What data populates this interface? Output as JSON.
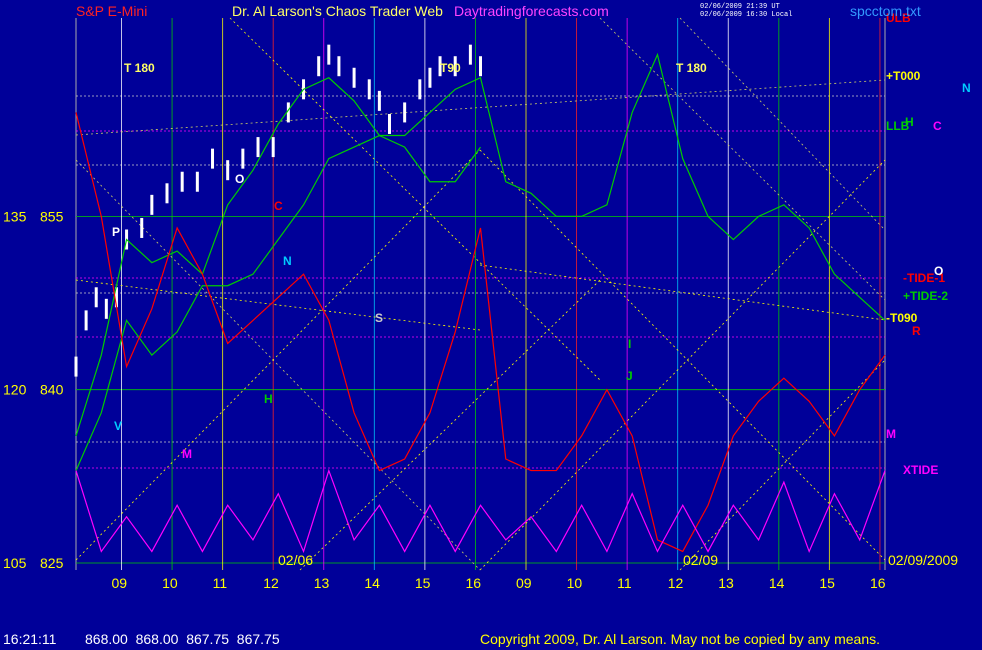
{
  "header": {
    "symbol": "S&P E-Mini",
    "title": "Dr. Al Larson's Chaos Trader Web",
    "site": "Daytradingforecasts.com",
    "stamp_line1": "02/06/2009 21:39 UT",
    "stamp_line2": "02/06/2009 16:30 Local",
    "file": "spcctom.txt"
  },
  "footer": {
    "time": "16:21:11",
    "ohlc": "868.00  868.00  867.75  867.75",
    "copyright": "Copyright 2009, Dr. Al Larson. May not be copied by any means."
  },
  "colors": {
    "background": "#000099",
    "price": "#ffffff",
    "green_line": "#00cc00",
    "red_line": "#ff0000",
    "magenta_line": "#ff00ff",
    "yellow": "#ffff00",
    "cyan": "#00ccff"
  },
  "chart_data": {
    "type": "line",
    "title": "S&P E-Mini",
    "y_ticks": [
      {
        "left": "135",
        "right": "855",
        "value": 855
      },
      {
        "left": "120",
        "right": "840",
        "value": 840
      },
      {
        "left": "105",
        "right": "825",
        "value": 825
      }
    ],
    "ylim": [
      825,
      872
    ],
    "x_ticks": [
      "09",
      "10",
      "11",
      "12",
      "13",
      "14",
      "15",
      "16",
      "09",
      "10",
      "11",
      "12",
      "13",
      "14",
      "15",
      "16"
    ],
    "date_labels": [
      "02/06",
      "02/09",
      "02/09/2009"
    ],
    "right_labels": [
      "ULB",
      "+T000",
      "LLB",
      "-TIDE-1",
      "+TIDE-2",
      "-T090",
      "R",
      "M",
      "XTIDE"
    ],
    "side_letters": [
      "N",
      "H",
      "C",
      "O"
    ],
    "annotations": [
      "T 180",
      "T90",
      "T 180",
      "O",
      "C",
      "P",
      "N",
      "S",
      "H",
      "M",
      "V",
      "I",
      "J"
    ],
    "series": [
      {
        "name": "price",
        "kind": "bars",
        "x": [
          0.0,
          0.2,
          0.4,
          0.6,
          0.8,
          1.0,
          1.3,
          1.5,
          1.8,
          2.1,
          2.4,
          2.7,
          3.0,
          3.3,
          3.6,
          3.9,
          4.2,
          4.5,
          4.8,
          5.0,
          5.2,
          5.5,
          5.8,
          6.0,
          6.2,
          6.5,
          6.8,
          7.0,
          7.2,
          7.5,
          7.8,
          8.0
        ],
        "y": [
          842,
          846,
          848,
          847,
          848,
          853,
          854,
          856,
          857,
          858,
          858,
          860,
          859,
          860,
          861,
          861,
          864,
          866,
          868,
          869,
          868,
          867,
          866,
          865,
          863,
          864,
          866,
          867,
          868,
          868,
          869,
          868
        ]
      },
      {
        "name": "green_upper",
        "x": [
          0,
          0.5,
          1,
          1.5,
          2,
          2.5,
          3,
          3.5,
          4,
          4.5,
          5,
          5.5,
          6,
          6.5,
          7,
          7.5,
          8,
          8.5,
          9,
          9.5,
          10,
          10.5,
          11,
          11.5,
          12,
          12.5,
          13,
          13.5,
          14,
          14.5,
          15,
          15.5,
          16
        ],
        "y": [
          836,
          843,
          853,
          851,
          852,
          850,
          856,
          859,
          863,
          866,
          867,
          865,
          862,
          862,
          864,
          866,
          867,
          858,
          857,
          855,
          855,
          856,
          864,
          869,
          860,
          855,
          853,
          855,
          856,
          854,
          850,
          848,
          846
        ]
      },
      {
        "name": "green_lower",
        "x": [
          0,
          0.5,
          1,
          1.5,
          2,
          2.5,
          3,
          3.5,
          4,
          4.5,
          5,
          5.5,
          6,
          6.5,
          7,
          7.5,
          8
        ],
        "y": [
          833,
          838,
          846,
          843,
          845,
          849,
          849,
          850,
          853,
          856,
          860,
          861,
          862,
          861,
          858,
          858,
          861
        ]
      },
      {
        "name": "red_cycle",
        "x": [
          0,
          0.5,
          1,
          1.5,
          2,
          2.5,
          3,
          3.5,
          4,
          4.5,
          5,
          5.5,
          6,
          6.5,
          7,
          7.5,
          8,
          8.5,
          9,
          9.5,
          10,
          10.5,
          11,
          11.5,
          12,
          12.5,
          13,
          13.5,
          14,
          14.5,
          15,
          15.5,
          16
        ],
        "y": [
          864,
          855,
          842,
          847,
          854,
          850,
          844,
          846,
          848,
          850,
          846,
          838,
          833,
          834,
          838,
          845,
          854,
          834,
          833,
          833,
          836,
          840,
          836,
          827,
          826,
          830,
          836,
          839,
          841,
          839,
          836,
          840,
          843
        ]
      },
      {
        "name": "xtide",
        "x": [
          0,
          0.5,
          1,
          1.5,
          2,
          2.5,
          3,
          3.5,
          4,
          4.5,
          5,
          5.5,
          6,
          6.5,
          7,
          7.5,
          8,
          8.5,
          9,
          9.5,
          10,
          10.5,
          11,
          11.5,
          12,
          12.5,
          13,
          13.5,
          14,
          14.5,
          15,
          15.5,
          16
        ],
        "y": [
          833,
          826,
          829,
          826,
          830,
          826,
          830,
          827,
          831,
          826,
          833,
          827,
          830,
          826,
          830,
          826,
          830,
          827,
          829,
          826,
          830,
          826,
          831,
          826,
          830,
          826,
          830,
          827,
          832,
          826,
          831,
          827,
          833
        ]
      }
    ]
  }
}
